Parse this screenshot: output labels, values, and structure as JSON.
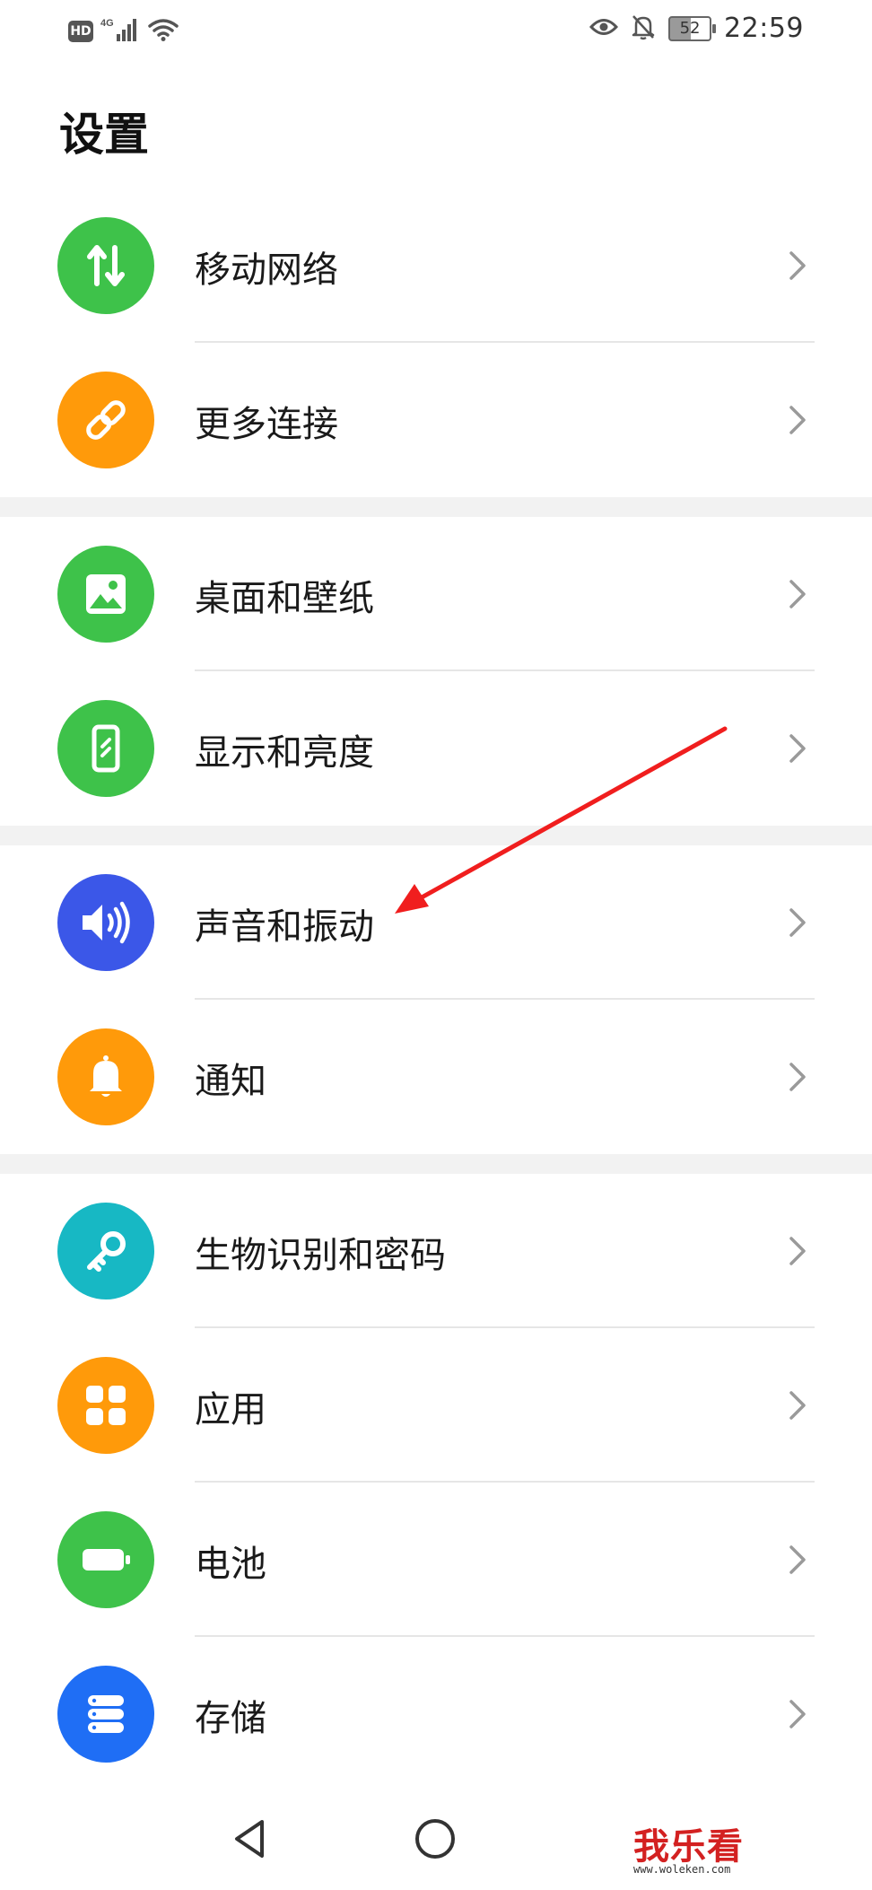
{
  "status_bar": {
    "hd_label": "HD",
    "network_label": "4G",
    "battery_level": "52",
    "time": "22:59"
  },
  "page": {
    "title": "设置"
  },
  "groups": [
    {
      "items": [
        {
          "label": "移动网络",
          "icon": "mobile-network-icon",
          "color": "#3ec24a"
        },
        {
          "label": "更多连接",
          "icon": "link-icon",
          "color": "#ff9a0a"
        }
      ]
    },
    {
      "items": [
        {
          "label": "桌面和壁纸",
          "icon": "wallpaper-icon",
          "color": "#3ec24a"
        },
        {
          "label": "显示和亮度",
          "icon": "display-icon",
          "color": "#3ec24a"
        }
      ]
    },
    {
      "items": [
        {
          "label": "声音和振动",
          "icon": "sound-icon",
          "color": "#3b57e8"
        },
        {
          "label": "通知",
          "icon": "bell-icon",
          "color": "#ff9a0a"
        }
      ]
    },
    {
      "items": [
        {
          "label": "生物识别和密码",
          "icon": "key-icon",
          "color": "#17b8c4"
        },
        {
          "label": "应用",
          "icon": "apps-icon",
          "color": "#ff9a0a"
        },
        {
          "label": "电池",
          "icon": "battery-icon",
          "color": "#3ec24a"
        },
        {
          "label": "存储",
          "icon": "storage-icon",
          "color": "#1f6ef5"
        }
      ]
    }
  ],
  "annotation": {
    "color": "#f01e1e",
    "target": "声音和振动"
  },
  "watermark": {
    "text": "我乐看",
    "subtext": "www.woleken.com"
  }
}
